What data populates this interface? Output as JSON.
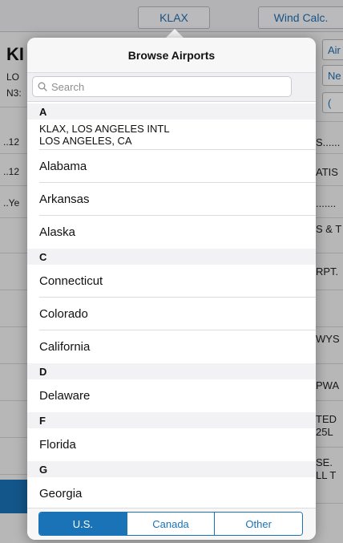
{
  "topbar": {
    "airport_button": "KLAX",
    "wind_button": "Wind Calc."
  },
  "background": {
    "left": {
      "code_partial": "KI",
      "city_partial": "LO",
      "coord_partial": "N3:",
      "rows": [
        "..12",
        "..12",
        "..Ye"
      ]
    },
    "right": {
      "buttons": [
        "Air",
        "Ne",
        "("
      ],
      "rows": [
        "S......",
        "ATIS",
        ".......",
        "S & T",
        "RPT.",
        "WYS",
        "PWA",
        "TED",
        "25L",
        "SE.",
        "LL T"
      ]
    }
  },
  "popover": {
    "title": "Browse Airports",
    "search": {
      "placeholder": "Search",
      "icon": "search-icon"
    },
    "sections": [
      {
        "header": "A",
        "items": [
          {
            "line1": "KLAX, LOS ANGELES INTL",
            "line2": "LOS ANGELES, CA"
          },
          {
            "label": "Alabama"
          },
          {
            "label": "Arkansas"
          },
          {
            "label": "Alaska"
          }
        ]
      },
      {
        "header": "C",
        "items": [
          {
            "label": "Connecticut"
          },
          {
            "label": "Colorado"
          },
          {
            "label": "California"
          }
        ]
      },
      {
        "header": "D",
        "items": [
          {
            "label": "Delaware"
          }
        ]
      },
      {
        "header": "F",
        "items": [
          {
            "label": "Florida"
          }
        ]
      },
      {
        "header": "G",
        "items": [
          {
            "label": "Georgia"
          }
        ]
      }
    ],
    "segments": {
      "options": [
        "U.S.",
        "Canada",
        "Other"
      ],
      "selected": "U.S."
    }
  },
  "colors": {
    "accent": "#1a73b7",
    "dim_overlay": "rgba(0,0,0,0.25)"
  }
}
